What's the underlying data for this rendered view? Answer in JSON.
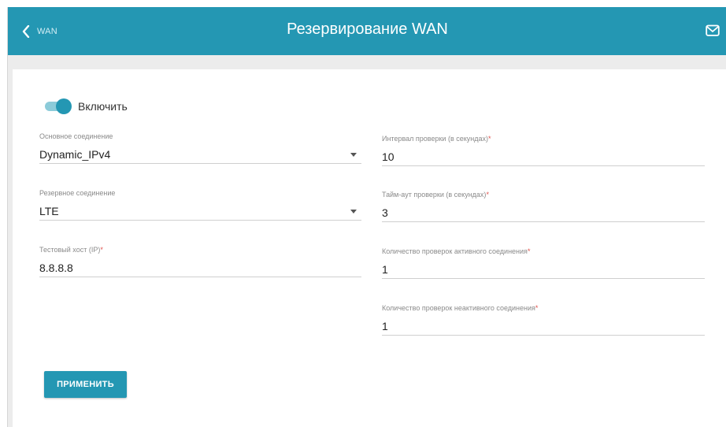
{
  "header": {
    "back_label": "WAN",
    "title": "Резервирование WAN",
    "back_icon": "chevron-left-icon",
    "mail_icon": "mail-icon"
  },
  "colors": {
    "accent": "#2497b3",
    "background": "#ececec",
    "required": "#e0504b"
  },
  "toggle": {
    "label": "Включить",
    "state": "on"
  },
  "left_fields": [
    {
      "label": "Основное соединение",
      "required": "",
      "value": "Dynamic_IPv4",
      "type": "select"
    },
    {
      "label": "Резервное соединение",
      "required": "",
      "value": "LTE",
      "type": "select"
    },
    {
      "label": "Тестовый хост (IP)",
      "required": "*",
      "value": "8.8.8.8",
      "type": "text"
    }
  ],
  "right_fields": [
    {
      "label": "Интервал проверки (в секундах)",
      "required": "*",
      "value": "10",
      "type": "text"
    },
    {
      "label": "Тайм-аут проверки (в секундах)",
      "required": "*",
      "value": "3",
      "type": "text"
    },
    {
      "label": "Количество проверок активного соединения",
      "required": "*",
      "value": "1",
      "type": "text"
    },
    {
      "label": "Количество проверок неактивного соединения",
      "required": "*",
      "value": "1",
      "type": "text"
    }
  ],
  "apply_button": "ПРИМЕНИТЬ"
}
